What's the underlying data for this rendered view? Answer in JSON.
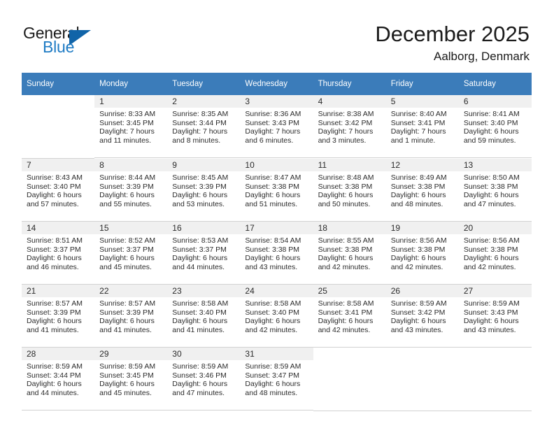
{
  "brand": {
    "name_top": "General",
    "name_bottom": "Blue",
    "triangle_icon": "triangle-icon",
    "accent_color": "#1164a8",
    "blue_text_color": "#1e7bc4"
  },
  "header": {
    "title": "December 2025",
    "subtitle": "Aalborg, Denmark"
  },
  "calendar": {
    "header_bg_color": "#3b7cba",
    "shaded_row_color": "#f0f0f0",
    "weekdays": [
      "Sunday",
      "Monday",
      "Tuesday",
      "Wednesday",
      "Thursday",
      "Friday",
      "Saturday"
    ],
    "weeks": [
      [
        {
          "day": "",
          "sunrise": "",
          "sunset": "",
          "daylight_line1": "",
          "daylight_line2": "",
          "empty": true
        },
        {
          "day": "1",
          "sunrise": "Sunrise: 8:33 AM",
          "sunset": "Sunset: 3:45 PM",
          "daylight_line1": "Daylight: 7 hours",
          "daylight_line2": "and 11 minutes."
        },
        {
          "day": "2",
          "sunrise": "Sunrise: 8:35 AM",
          "sunset": "Sunset: 3:44 PM",
          "daylight_line1": "Daylight: 7 hours",
          "daylight_line2": "and 8 minutes."
        },
        {
          "day": "3",
          "sunrise": "Sunrise: 8:36 AM",
          "sunset": "Sunset: 3:43 PM",
          "daylight_line1": "Daylight: 7 hours",
          "daylight_line2": "and 6 minutes."
        },
        {
          "day": "4",
          "sunrise": "Sunrise: 8:38 AM",
          "sunset": "Sunset: 3:42 PM",
          "daylight_line1": "Daylight: 7 hours",
          "daylight_line2": "and 3 minutes."
        },
        {
          "day": "5",
          "sunrise": "Sunrise: 8:40 AM",
          "sunset": "Sunset: 3:41 PM",
          "daylight_line1": "Daylight: 7 hours",
          "daylight_line2": "and 1 minute."
        },
        {
          "day": "6",
          "sunrise": "Sunrise: 8:41 AM",
          "sunset": "Sunset: 3:40 PM",
          "daylight_line1": "Daylight: 6 hours",
          "daylight_line2": "and 59 minutes."
        }
      ],
      [
        {
          "day": "7",
          "sunrise": "Sunrise: 8:43 AM",
          "sunset": "Sunset: 3:40 PM",
          "daylight_line1": "Daylight: 6 hours",
          "daylight_line2": "and 57 minutes."
        },
        {
          "day": "8",
          "sunrise": "Sunrise: 8:44 AM",
          "sunset": "Sunset: 3:39 PM",
          "daylight_line1": "Daylight: 6 hours",
          "daylight_line2": "and 55 minutes."
        },
        {
          "day": "9",
          "sunrise": "Sunrise: 8:45 AM",
          "sunset": "Sunset: 3:39 PM",
          "daylight_line1": "Daylight: 6 hours",
          "daylight_line2": "and 53 minutes."
        },
        {
          "day": "10",
          "sunrise": "Sunrise: 8:47 AM",
          "sunset": "Sunset: 3:38 PM",
          "daylight_line1": "Daylight: 6 hours",
          "daylight_line2": "and 51 minutes."
        },
        {
          "day": "11",
          "sunrise": "Sunrise: 8:48 AM",
          "sunset": "Sunset: 3:38 PM",
          "daylight_line1": "Daylight: 6 hours",
          "daylight_line2": "and 50 minutes."
        },
        {
          "day": "12",
          "sunrise": "Sunrise: 8:49 AM",
          "sunset": "Sunset: 3:38 PM",
          "daylight_line1": "Daylight: 6 hours",
          "daylight_line2": "and 48 minutes."
        },
        {
          "day": "13",
          "sunrise": "Sunrise: 8:50 AM",
          "sunset": "Sunset: 3:38 PM",
          "daylight_line1": "Daylight: 6 hours",
          "daylight_line2": "and 47 minutes."
        }
      ],
      [
        {
          "day": "14",
          "sunrise": "Sunrise: 8:51 AM",
          "sunset": "Sunset: 3:37 PM",
          "daylight_line1": "Daylight: 6 hours",
          "daylight_line2": "and 46 minutes."
        },
        {
          "day": "15",
          "sunrise": "Sunrise: 8:52 AM",
          "sunset": "Sunset: 3:37 PM",
          "daylight_line1": "Daylight: 6 hours",
          "daylight_line2": "and 45 minutes."
        },
        {
          "day": "16",
          "sunrise": "Sunrise: 8:53 AM",
          "sunset": "Sunset: 3:37 PM",
          "daylight_line1": "Daylight: 6 hours",
          "daylight_line2": "and 44 minutes."
        },
        {
          "day": "17",
          "sunrise": "Sunrise: 8:54 AM",
          "sunset": "Sunset: 3:38 PM",
          "daylight_line1": "Daylight: 6 hours",
          "daylight_line2": "and 43 minutes."
        },
        {
          "day": "18",
          "sunrise": "Sunrise: 8:55 AM",
          "sunset": "Sunset: 3:38 PM",
          "daylight_line1": "Daylight: 6 hours",
          "daylight_line2": "and 42 minutes."
        },
        {
          "day": "19",
          "sunrise": "Sunrise: 8:56 AM",
          "sunset": "Sunset: 3:38 PM",
          "daylight_line1": "Daylight: 6 hours",
          "daylight_line2": "and 42 minutes."
        },
        {
          "day": "20",
          "sunrise": "Sunrise: 8:56 AM",
          "sunset": "Sunset: 3:38 PM",
          "daylight_line1": "Daylight: 6 hours",
          "daylight_line2": "and 42 minutes."
        }
      ],
      [
        {
          "day": "21",
          "sunrise": "Sunrise: 8:57 AM",
          "sunset": "Sunset: 3:39 PM",
          "daylight_line1": "Daylight: 6 hours",
          "daylight_line2": "and 41 minutes."
        },
        {
          "day": "22",
          "sunrise": "Sunrise: 8:57 AM",
          "sunset": "Sunset: 3:39 PM",
          "daylight_line1": "Daylight: 6 hours",
          "daylight_line2": "and 41 minutes."
        },
        {
          "day": "23",
          "sunrise": "Sunrise: 8:58 AM",
          "sunset": "Sunset: 3:40 PM",
          "daylight_line1": "Daylight: 6 hours",
          "daylight_line2": "and 41 minutes."
        },
        {
          "day": "24",
          "sunrise": "Sunrise: 8:58 AM",
          "sunset": "Sunset: 3:40 PM",
          "daylight_line1": "Daylight: 6 hours",
          "daylight_line2": "and 42 minutes."
        },
        {
          "day": "25",
          "sunrise": "Sunrise: 8:58 AM",
          "sunset": "Sunset: 3:41 PM",
          "daylight_line1": "Daylight: 6 hours",
          "daylight_line2": "and 42 minutes."
        },
        {
          "day": "26",
          "sunrise": "Sunrise: 8:59 AM",
          "sunset": "Sunset: 3:42 PM",
          "daylight_line1": "Daylight: 6 hours",
          "daylight_line2": "and 43 minutes."
        },
        {
          "day": "27",
          "sunrise": "Sunrise: 8:59 AM",
          "sunset": "Sunset: 3:43 PM",
          "daylight_line1": "Daylight: 6 hours",
          "daylight_line2": "and 43 minutes."
        }
      ],
      [
        {
          "day": "28",
          "sunrise": "Sunrise: 8:59 AM",
          "sunset": "Sunset: 3:44 PM",
          "daylight_line1": "Daylight: 6 hours",
          "daylight_line2": "and 44 minutes."
        },
        {
          "day": "29",
          "sunrise": "Sunrise: 8:59 AM",
          "sunset": "Sunset: 3:45 PM",
          "daylight_line1": "Daylight: 6 hours",
          "daylight_line2": "and 45 minutes."
        },
        {
          "day": "30",
          "sunrise": "Sunrise: 8:59 AM",
          "sunset": "Sunset: 3:46 PM",
          "daylight_line1": "Daylight: 6 hours",
          "daylight_line2": "and 47 minutes."
        },
        {
          "day": "31",
          "sunrise": "Sunrise: 8:59 AM",
          "sunset": "Sunset: 3:47 PM",
          "daylight_line1": "Daylight: 6 hours",
          "daylight_line2": "and 48 minutes."
        },
        {
          "day": "",
          "sunrise": "",
          "sunset": "",
          "daylight_line1": "",
          "daylight_line2": "",
          "empty": true
        },
        {
          "day": "",
          "sunrise": "",
          "sunset": "",
          "daylight_line1": "",
          "daylight_line2": "",
          "empty": true
        },
        {
          "day": "",
          "sunrise": "",
          "sunset": "",
          "daylight_line1": "",
          "daylight_line2": "",
          "empty": true
        }
      ]
    ]
  }
}
